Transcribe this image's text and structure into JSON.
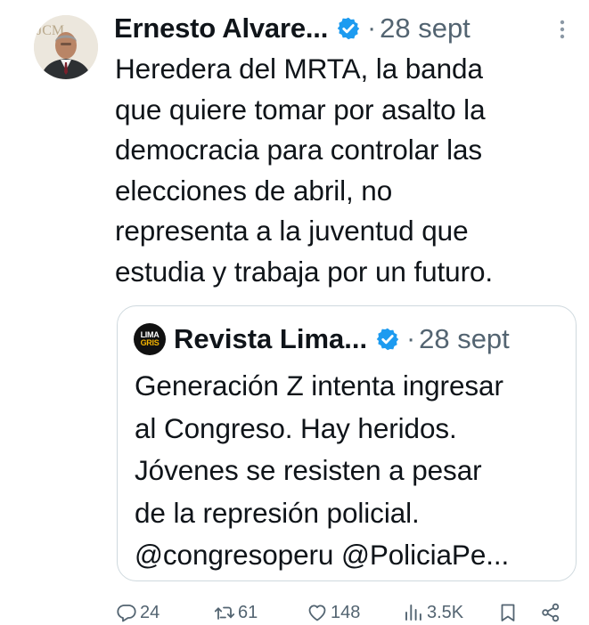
{
  "tweet": {
    "author_name": "Ernesto Alvare...",
    "separator": "·",
    "date": "28 sept",
    "avatar_icon": "profile-photo",
    "lines": [
      "Heredera del MRTA, la banda",
      "que quiere tomar por asalto la",
      "democracia para controlar las",
      "elecciones de abril, no",
      "representa a la juventud que",
      "estudia y trabaja por un futuro."
    ]
  },
  "quote": {
    "author_name": "Revista Lima...",
    "separator": "·",
    "date": "28 sept",
    "avatar_line1": "LIMA",
    "avatar_line2": "GRIS",
    "lines": [
      "Generación Z intenta ingresar",
      "al Congreso. Hay heridos.",
      "Jóvenes se resisten a pesar",
      "de la represión policial.",
      "@congresoperu @PoliciaPe..."
    ]
  },
  "actions": {
    "replies": "24",
    "reposts": "61",
    "likes": "148",
    "views": "3.5K"
  },
  "colors": {
    "text": "#0f1419",
    "muted": "#536471",
    "verified": "#1d9bf0",
    "border": "#cfd9de"
  }
}
